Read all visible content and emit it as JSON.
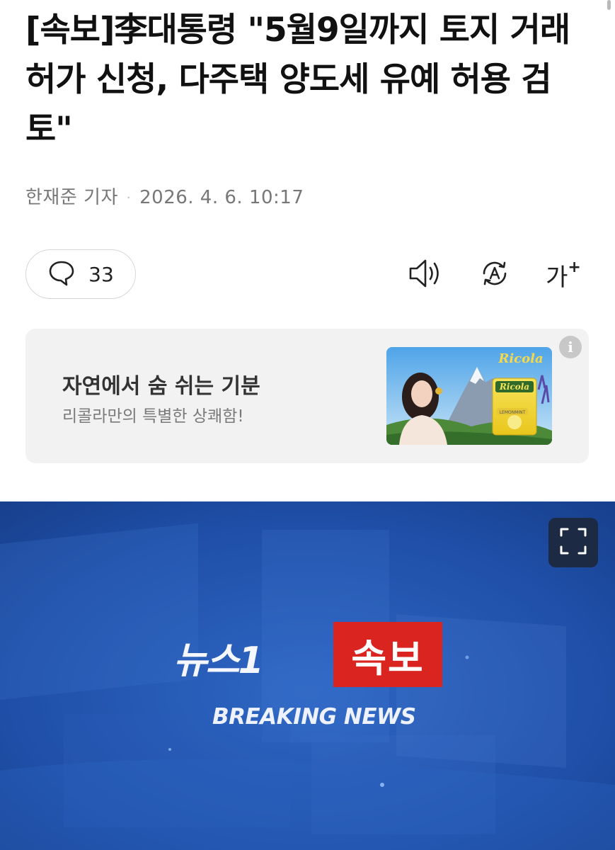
{
  "article": {
    "headline": "[속보]李대통령 \"5월9일까지 토지 거래허가 신청, 다주택 양도세 유예 허용 검토\"",
    "reporter": "한재준 기자",
    "separator": "·",
    "timestamp": "2026. 4. 6. 10:17"
  },
  "toolbar": {
    "comment_count": "33",
    "font_size_label": "가",
    "font_size_plus": "+"
  },
  "ad": {
    "title": "자연에서 숨 쉬는 기분",
    "subtitle": "리콜라만의 특별한 상쾌함!",
    "info_label": "i",
    "brand_name": "Ricola",
    "product_label": "LEMONMINT"
  },
  "photo": {
    "brand_text": "뉴스1",
    "badge_text": "속보",
    "caption_text": "BREAKING NEWS"
  },
  "colors": {
    "badge_red": "#d9241f",
    "photo_blue": "#1f4fa8",
    "expand_button": "#1d2a44"
  },
  "icons": {
    "comment": "speech-bubble-icon",
    "audio": "speaker-icon",
    "translate": "auto-translate-icon",
    "expand": "fullscreen-icon",
    "info": "info-icon"
  }
}
